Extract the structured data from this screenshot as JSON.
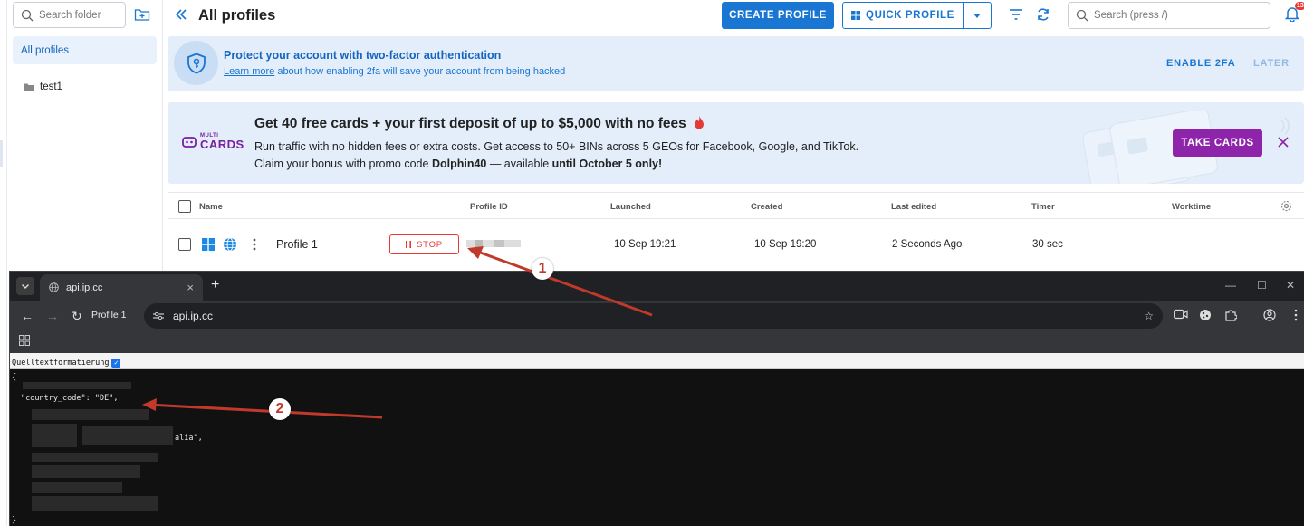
{
  "sidebar": {
    "search_placeholder": "Search folder",
    "all_profiles": "All profiles",
    "folders": [
      "test1"
    ]
  },
  "header": {
    "title": "All profiles",
    "create_profile": "CREATE PROFILE",
    "quick_profile": "QUICK PROFILE",
    "search_placeholder": "Search (press /)",
    "notification_count": "13"
  },
  "twofa_banner": {
    "title": "Protect your account with two-factor authentication",
    "learn_more": "Learn more",
    "subtitle_rest": " about how enabling 2fa will save your account from being hacked",
    "enable": "ENABLE 2FA",
    "later": "LATER"
  },
  "cards_banner": {
    "logo_small": "MULTI",
    "logo_large": "CARDS",
    "title": "Get 40 free cards + your first deposit of up to $5,000 with no fees",
    "line1": "Run traffic with no hidden fees or extra costs. Get access to 50+ BINs across 5 GEOs for Facebook, Google, and TikTok.",
    "line2_a": "Claim your bonus with promo code ",
    "promo_code": "Dolphin40",
    "line2_b": " — available ",
    "deadline": "until October 5 only!",
    "button": "TAKE CARDS"
  },
  "table": {
    "columns": [
      "Name",
      "Profile ID",
      "Launched",
      "Created",
      "Last edited",
      "Timer",
      "Worktime"
    ],
    "rows": [
      {
        "name": "Profile 1",
        "action": "STOP",
        "launched": "10 Sep 19:21",
        "created": "10 Sep 19:20",
        "last_edited": "2 Seconds Ago",
        "timer": "30 sec"
      }
    ]
  },
  "browser": {
    "tab_title": "api.ip.cc",
    "profile_chip": "Profile 1",
    "url": "api.ip.cc",
    "pretty_print_label": "Quelltextformatierung",
    "json_lines": [
      "{",
      "\"country_code\": \"DE\",",
      "alia\",",
      "}"
    ]
  },
  "annotations": [
    "1",
    "2"
  ],
  "colors": {
    "primary": "#1976d2",
    "stop": "#e53935",
    "take_cards": "#8e24aa",
    "banner_bg": "#e3eefa",
    "arrow": "#c0392b"
  }
}
